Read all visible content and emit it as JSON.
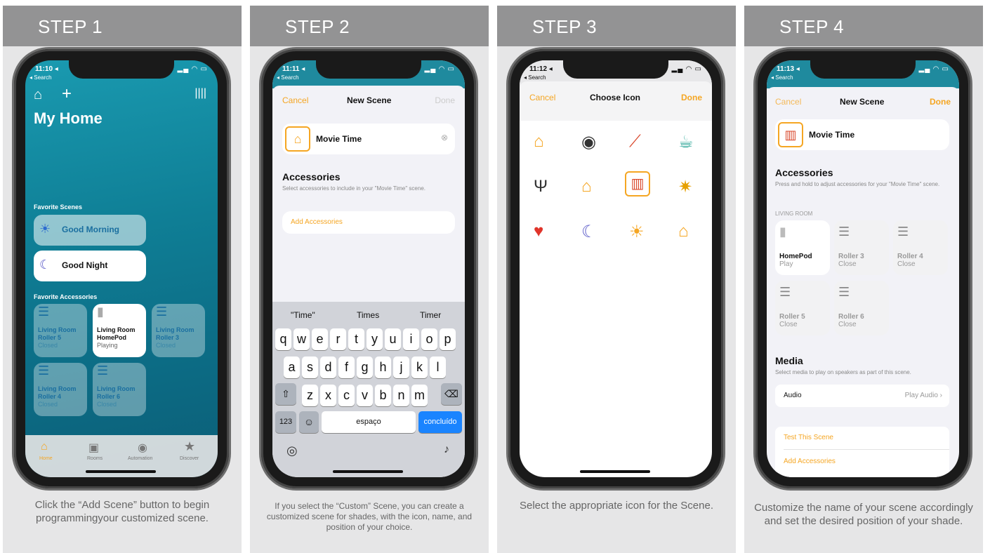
{
  "steps": [
    {
      "title": "STEP 1",
      "caption": "Click the “Add Scene” button to begin programmingyour customized scene.",
      "time": "11:10 ◂",
      "search": "◂ Search"
    },
    {
      "title": "STEP 2",
      "caption": "If you select the “Custom” Scene, you can create a customized scene for shades, with the icon, name, and position of your choice.",
      "time": "11:11 ◂",
      "search": "◂ Search"
    },
    {
      "title": "STEP 3",
      "caption": "Select the appropriate icon for the Scene.",
      "time": "11:12 ◂",
      "search": "◂ Search"
    },
    {
      "title": "STEP 4",
      "caption": "Customize the name of your scene accordingly and set the desired position of your shade.",
      "time": "11:13 ◂",
      "search": "◂ Search"
    }
  ],
  "s1": {
    "title": "My Home",
    "fav_scenes": "Favorite Scenes",
    "good_morning": "Good Morning",
    "good_night": "Good Night",
    "fav_acc": "Favorite Accessories",
    "tiles": [
      {
        "l1": "Living Room",
        "l2": "Roller 5",
        "l3": "Closed"
      },
      {
        "l1": "Living Room",
        "l2": "HomePod",
        "l3": "Playing"
      },
      {
        "l1": "Living Room",
        "l2": "Roller 3",
        "l3": "Closed"
      },
      {
        "l1": "Living Room",
        "l2": "Roller 4",
        "l3": "Closed"
      },
      {
        "l1": "Living Room",
        "l2": "Roller 6",
        "l3": "Closed"
      }
    ],
    "tabs": [
      "Home",
      "Rooms",
      "Automation",
      "Discover"
    ]
  },
  "s2": {
    "cancel": "Cancel",
    "title": "New Scene",
    "done": "Done",
    "name": "Movie Time",
    "acc": "Accessories",
    "acc_sub": "Select accessories to include in your \"Movie Time\" scene.",
    "add": "Add Accessories",
    "sugg": [
      "\"Time\"",
      "Times",
      "Timer"
    ],
    "row1": [
      "q",
      "w",
      "e",
      "r",
      "t",
      "y",
      "u",
      "i",
      "o",
      "p"
    ],
    "row2": [
      "a",
      "s",
      "d",
      "f",
      "g",
      "h",
      "j",
      "k",
      "l"
    ],
    "row3": [
      "z",
      "x",
      "c",
      "v",
      "b",
      "n",
      "m"
    ],
    "k123": "123",
    "space": "espaço",
    "go": "concluído"
  },
  "s3": {
    "cancel": "Cancel",
    "title": "Choose Icon",
    "done": "Done"
  },
  "s4": {
    "cancel": "Cancel",
    "title": "New Scene",
    "done": "Done",
    "name": "Movie Time",
    "acc": "Accessories",
    "acc_sub": "Press and hold to adjust accessories for your \"Movie Time\" scene.",
    "room": "LIVING ROOM",
    "tiles": [
      {
        "l1": "HomePod",
        "l2": "Play"
      },
      {
        "l1": "Roller 3",
        "l2": "Close"
      },
      {
        "l1": "Roller 4",
        "l2": "Close"
      },
      {
        "l1": "Roller 5",
        "l2": "Close"
      },
      {
        "l1": "Roller 6",
        "l2": "Close"
      }
    ],
    "media": "Media",
    "media_sub": "Select media to play on speakers as part of this scene.",
    "audio": "Audio",
    "play_audio": "Play Audio ›",
    "test": "Test This Scene",
    "add": "Add Accessories"
  }
}
